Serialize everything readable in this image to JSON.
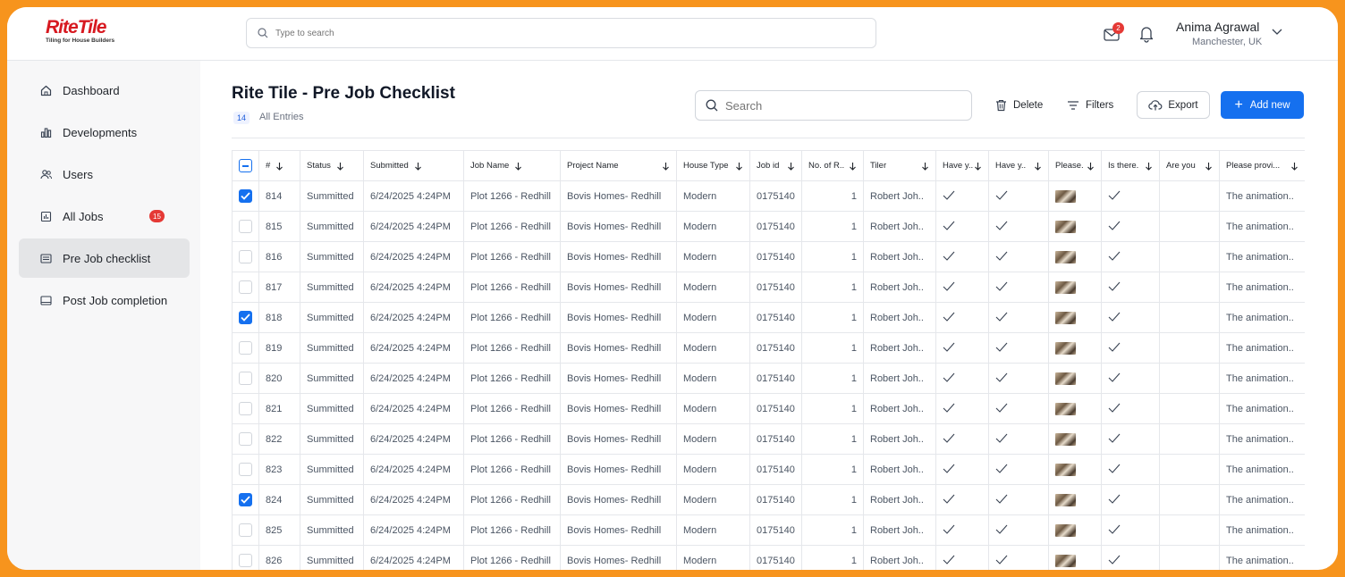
{
  "brand": {
    "name_part1": "Rite",
    "name_part2": "Tile",
    "tagline": "Tiling for House Builders"
  },
  "topbar": {
    "search_placeholder": "Type to search",
    "mail_count": "2",
    "user_name": "Anima Agrawal",
    "user_location": "Manchester, UK"
  },
  "sidebar": {
    "items": [
      {
        "label": "Dashboard",
        "icon": "home-icon"
      },
      {
        "label": "Developments",
        "icon": "chart-icon"
      },
      {
        "label": "Users",
        "icon": "users-icon"
      },
      {
        "label": "All Jobs",
        "icon": "bar-chart-icon",
        "badge": "15"
      },
      {
        "label": "Pre Job checklist",
        "icon": "list-icon",
        "active": true
      },
      {
        "label": "Post Job completion",
        "icon": "card-icon"
      }
    ]
  },
  "main": {
    "title": "Rite Tile - Pre Job Checklist",
    "entries_count": "14",
    "entries_label": "All Entries",
    "search_placeholder": "Search",
    "delete_label": "Delete",
    "filters_label": "Filters",
    "export_label": "Export",
    "add_label": "Add new"
  },
  "table": {
    "headers": [
      "#",
      "Status",
      "Submitted",
      "Job Name",
      "Project Name",
      "House Type",
      "Job id",
      "No. of R..",
      "Tiler",
      "Have y..",
      "Have y..",
      "Please.",
      "Is there.",
      "Are you",
      "Please provi..."
    ],
    "rows": [
      {
        "checked": true,
        "id": "814",
        "status": "Summitted",
        "submitted": "6/24/2025 4:24PM",
        "job": "Plot 1266 - Redhill",
        "project": "Bovis Homes-  Redhill",
        "house": "Modern",
        "jobid": "0175140",
        "rooms": "1",
        "tiler": "Robert Joh..",
        "note": "The animation.."
      },
      {
        "checked": false,
        "id": "815",
        "status": "Summitted",
        "submitted": "6/24/2025 4:24PM",
        "job": "Plot 1266 - Redhill",
        "project": "Bovis Homes-  Redhill",
        "house": "Modern",
        "jobid": "0175140",
        "rooms": "1",
        "tiler": "Robert Joh..",
        "note": "The animation.."
      },
      {
        "checked": false,
        "id": "816",
        "status": "Summitted",
        "submitted": "6/24/2025 4:24PM",
        "job": "Plot 1266 - Redhill",
        "project": "Bovis Homes-  Redhill",
        "house": "Modern",
        "jobid": "0175140",
        "rooms": "1",
        "tiler": "Robert Joh..",
        "note": "The animation.."
      },
      {
        "checked": false,
        "id": "817",
        "status": "Summitted",
        "submitted": "6/24/2025 4:24PM",
        "job": "Plot 1266 - Redhill",
        "project": "Bovis Homes-  Redhill",
        "house": "Modern",
        "jobid": "0175140",
        "rooms": "1",
        "tiler": "Robert Joh..",
        "note": "The animation.."
      },
      {
        "checked": true,
        "id": "818",
        "status": "Summitted",
        "submitted": "6/24/2025 4:24PM",
        "job": "Plot 1266 - Redhill",
        "project": "Bovis Homes-  Redhill",
        "house": "Modern",
        "jobid": "0175140",
        "rooms": "1",
        "tiler": "Robert Joh..",
        "note": "The animation.."
      },
      {
        "checked": false,
        "id": "819",
        "status": "Summitted",
        "submitted": "6/24/2025 4:24PM",
        "job": "Plot 1266 - Redhill",
        "project": "Bovis Homes-  Redhill",
        "house": "Modern",
        "jobid": "0175140",
        "rooms": "1",
        "tiler": "Robert Joh..",
        "note": "The animation.."
      },
      {
        "checked": false,
        "id": "820",
        "status": "Summitted",
        "submitted": "6/24/2025 4:24PM",
        "job": "Plot 1266 - Redhill",
        "project": "Bovis Homes-  Redhill",
        "house": "Modern",
        "jobid": "0175140",
        "rooms": "1",
        "tiler": "Robert Joh..",
        "note": "The animation.."
      },
      {
        "checked": false,
        "id": "821",
        "status": "Summitted",
        "submitted": "6/24/2025 4:24PM",
        "job": "Plot 1266 - Redhill",
        "project": "Bovis Homes-  Redhill",
        "house": "Modern",
        "jobid": "0175140",
        "rooms": "1",
        "tiler": "Robert Joh..",
        "note": "The animation.."
      },
      {
        "checked": false,
        "id": "822",
        "status": "Summitted",
        "submitted": "6/24/2025 4:24PM",
        "job": "Plot 1266 - Redhill",
        "project": "Bovis Homes-  Redhill",
        "house": "Modern",
        "jobid": "0175140",
        "rooms": "1",
        "tiler": "Robert Joh..",
        "note": "The animation.."
      },
      {
        "checked": false,
        "id": "823",
        "status": "Summitted",
        "submitted": "6/24/2025 4:24PM",
        "job": "Plot 1266 - Redhill",
        "project": "Bovis Homes-  Redhill",
        "house": "Modern",
        "jobid": "0175140",
        "rooms": "1",
        "tiler": "Robert Joh..",
        "note": "The animation.."
      },
      {
        "checked": true,
        "id": "824",
        "status": "Summitted",
        "submitted": "6/24/2025 4:24PM",
        "job": "Plot 1266 - Redhill",
        "project": "Bovis Homes-  Redhill",
        "house": "Modern",
        "jobid": "0175140",
        "rooms": "1",
        "tiler": "Robert Joh..",
        "note": "The animation.."
      },
      {
        "checked": false,
        "id": "825",
        "status": "Summitted",
        "submitted": "6/24/2025 4:24PM",
        "job": "Plot 1266 - Redhill",
        "project": "Bovis Homes-  Redhill",
        "house": "Modern",
        "jobid": "0175140",
        "rooms": "1",
        "tiler": "Robert Joh..",
        "note": "The animation.."
      },
      {
        "checked": false,
        "id": "826",
        "status": "Summitted",
        "submitted": "6/24/2025 4:24PM",
        "job": "Plot 1266 - Redhill",
        "project": "Bovis Homes-  Redhill",
        "house": "Modern",
        "jobid": "0175140",
        "rooms": "1",
        "tiler": "Robert Joh..",
        "note": "The animation.."
      }
    ]
  },
  "colors": {
    "accent": "#1570ef",
    "badge": "#e53935",
    "brand": "#d71920",
    "frame": "#f7941d"
  }
}
